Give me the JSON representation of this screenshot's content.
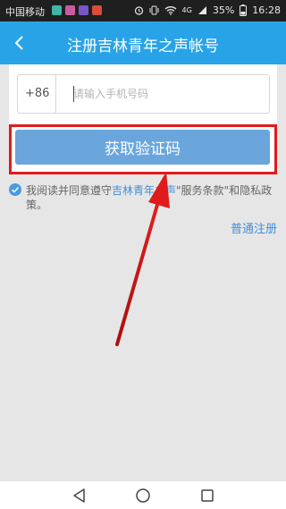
{
  "status_bar": {
    "carrier": "中国移动",
    "battery": "35%",
    "time": "16:28",
    "network": "4G",
    "notification_colors": [
      "#3fb6a8",
      "#c85ba0",
      "#7a55c8",
      "#d94d3a"
    ]
  },
  "header": {
    "title": "注册吉林青年之声帐号",
    "back_icon": "chevron-left-icon"
  },
  "form": {
    "country_code": "+86",
    "phone_placeholder": "请输入手机号码",
    "phone_value": "",
    "get_code_label": "获取验证码"
  },
  "agreement": {
    "checked": true,
    "prefix": "我阅读并同意遵守",
    "link": "吉林青年之声",
    "suffix": "\"服务条款\"和隐私政策。"
  },
  "normal_register_label": "普通注册",
  "nav": {
    "back": "nav-back-icon",
    "home": "nav-home-icon",
    "recents": "nav-recents-icon"
  },
  "colors": {
    "accent": "#29a3e8",
    "button": "#6aa6dc",
    "highlight": "#e01b1b",
    "link": "#3f8fdb"
  }
}
